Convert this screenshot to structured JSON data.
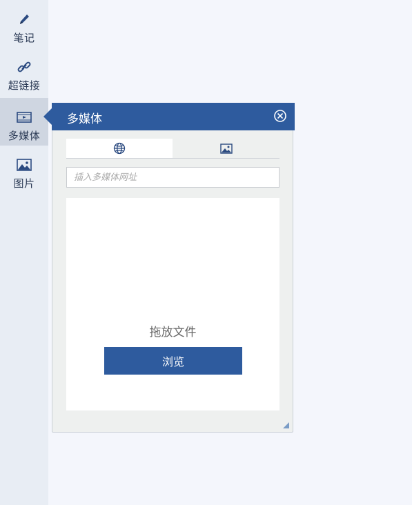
{
  "sidebar": {
    "items": [
      {
        "label": "笔记",
        "icon": "pen-icon"
      },
      {
        "label": "超链接",
        "icon": "link-icon"
      },
      {
        "label": "多媒体",
        "icon": "film-icon"
      },
      {
        "label": "图片",
        "icon": "image-icon"
      }
    ],
    "active_index": 2
  },
  "panel": {
    "title": "多媒体",
    "tabs": [
      {
        "icon": "globe-icon",
        "active": true
      },
      {
        "icon": "image-icon",
        "active": false
      }
    ],
    "url_input": {
      "value": "",
      "placeholder": "插入多媒体网址"
    },
    "drop_text": "拖放文件",
    "browse_label": "浏览"
  },
  "colors": {
    "accent": "#2e5b9e",
    "sidebar_bg": "#e8edf4",
    "sidebar_active": "#cfd6e1"
  }
}
